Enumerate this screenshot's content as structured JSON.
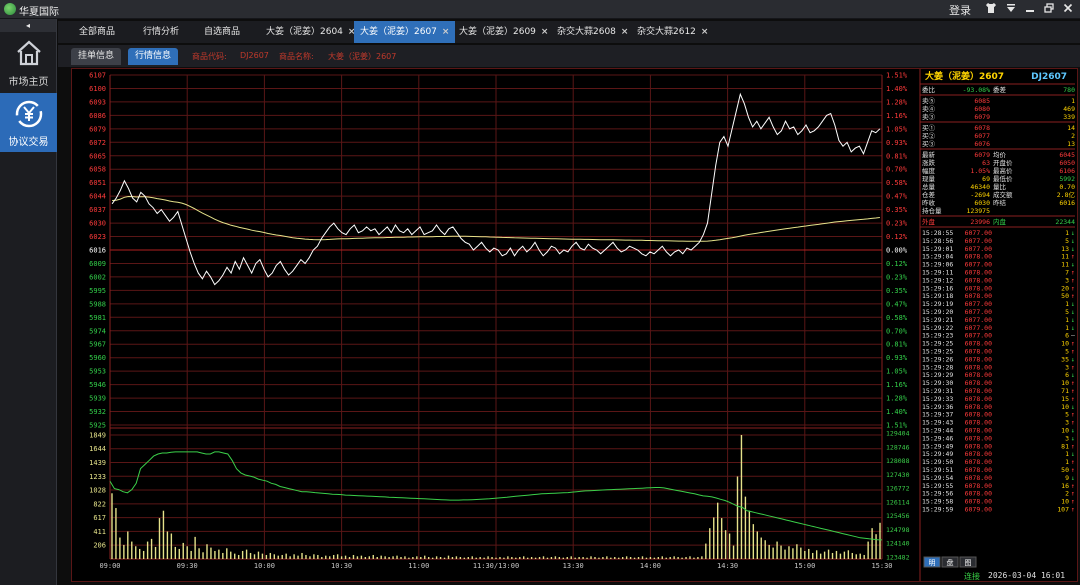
{
  "window": {
    "app_title": "华夏国际",
    "login_label": "登录",
    "icons": [
      "shirt-icon",
      "menu-dropdown-icon",
      "minimize-icon",
      "restore-icon",
      "close-icon"
    ]
  },
  "sidebar": {
    "collapse_glyph": "◂",
    "items": [
      {
        "label": "市场主页",
        "icon": "home-icon",
        "active": false
      },
      {
        "label": "协议交易",
        "icon": "yuan-exchange-icon",
        "active": true
      }
    ]
  },
  "tabs": [
    {
      "label": "全部商品",
      "closable": false,
      "active": false
    },
    {
      "label": "行情分析",
      "closable": false,
      "active": false
    },
    {
      "label": "自选商品",
      "closable": false,
      "active": false
    },
    {
      "label": "大姜（泥姜）2604",
      "closable": true,
      "active": false
    },
    {
      "label": "大姜（泥姜）2607",
      "closable": true,
      "active": true
    },
    {
      "label": "大姜（泥姜）2609",
      "closable": true,
      "active": false
    },
    {
      "label": "杂交大蒜2608",
      "closable": true,
      "active": false
    },
    {
      "label": "杂交大蒜2612",
      "closable": true,
      "active": false
    }
  ],
  "subtabs": {
    "order_info": "挂单信息",
    "quote_info": "行情信息",
    "code_label": "商品代码:",
    "code_value": "DJ2607",
    "name_label": "商品名称:",
    "name_value": "大姜（泥姜）2607"
  },
  "colors": {
    "price_line": "#ffffff",
    "avg_line": "#e5e28a",
    "volume_bar": "#e5e28a",
    "position_line": "#3bd04a",
    "grid": "#5a1616",
    "up": "#ff3b3b",
    "down": "#33d04a",
    "neutral": "#ffffff"
  },
  "chart_data": {
    "type": "line",
    "title": "",
    "price_ticks": [
      "6107",
      "6100",
      "6093",
      "6086",
      "6079",
      "6072",
      "6065",
      "6058",
      "6051",
      "6044",
      "6037",
      "6030",
      "6023",
      "6016",
      "6009",
      "6002",
      "5995",
      "5988",
      "5981",
      "5974",
      "5967",
      "5960",
      "5953",
      "5946",
      "5939",
      "5932",
      "5925"
    ],
    "pct_ticks": [
      "1.51%",
      "1.40%",
      "1.28%",
      "1.16%",
      "1.05%",
      "0.93%",
      "0.81%",
      "0.70%",
      "0.58%",
      "0.47%",
      "0.35%",
      "0.23%",
      "0.12%",
      "0.00%",
      "0.12%",
      "0.23%",
      "0.35%",
      "0.47%",
      "0.58%",
      "0.70%",
      "0.81%",
      "0.93%",
      "1.05%",
      "1.16%",
      "1.28%",
      "1.40%",
      "1.51%"
    ],
    "prev_close": 6016,
    "volume_ticks": [
      "1849",
      "1644",
      "1439",
      "1233",
      "1028",
      "822",
      "617",
      "411",
      "206"
    ],
    "position_ticks": [
      "129404",
      "128746",
      "128088",
      "127430",
      "126772",
      "126114",
      "125456",
      "124798",
      "124140",
      "123482"
    ],
    "time_ticks": [
      "09:00",
      "09:30",
      "10:00",
      "10:30",
      "11:00",
      "11:30/13:00",
      "13:30",
      "14:00",
      "14:30",
      "15:00",
      "15:30"
    ],
    "price_series": [
      6040,
      6043,
      6047,
      6052,
      6048,
      6043,
      6041,
      6046,
      6044,
      6040,
      6038,
      6035,
      6037,
      6034,
      6031,
      6033,
      6036,
      6029,
      6022,
      6015,
      6009,
      6004,
      6001,
      6005,
      6002,
      5998,
      6000,
      6003,
      6007,
      6004,
      6010,
      6006,
      6012,
      6008,
      6004,
      6009,
      6011,
      6006,
      6002,
      6004,
      6008,
      6010,
      6006,
      6003,
      6005,
      6008,
      6011,
      6009,
      6012,
      6016,
      6018,
      6022,
      6025,
      6028,
      6030,
      6027,
      6025,
      6024,
      6027,
      6029,
      6025,
      6026,
      6028,
      6026,
      6027,
      6024,
      6026,
      6028,
      6025,
      6029,
      6026,
      6025,
      6027,
      6024,
      6026,
      6028,
      6024,
      6025,
      6026,
      6029,
      6026,
      6024,
      6027,
      6028,
      6025,
      6022,
      6020,
      6019,
      6016,
      6018,
      6020,
      6017,
      6015,
      6017,
      6016,
      6013,
      6014,
      6017,
      6013,
      6016,
      6018,
      6015,
      6017,
      6020,
      6016,
      6013,
      6015,
      6018,
      6017,
      6014,
      6016,
      6015,
      6018,
      6020,
      6017,
      6016,
      6019,
      6017,
      6016,
      6014,
      6016,
      6018,
      6020,
      6017,
      6015,
      6016,
      6018,
      6017,
      6016,
      6014,
      6013,
      6015,
      6014,
      6016,
      6018,
      6015,
      6013,
      6015,
      6016,
      6014,
      6017,
      6016,
      6018,
      6020,
      6024,
      6030,
      6045,
      6060,
      6072,
      6075,
      6070,
      6079,
      6088,
      6097,
      6092,
      6085,
      6080,
      6083,
      6079,
      6082,
      6085,
      6080,
      6076,
      6078,
      6083,
      6079,
      6080,
      6076,
      6078,
      6081,
      6077,
      6078,
      6080,
      6083,
      6086,
      6087,
      6081,
      6073,
      6070,
      6072,
      6067,
      6069,
      6070,
      6066,
      6072,
      6078,
      6077,
      6079
    ],
    "avg_series_start": 6042,
    "volume_series": [
      980,
      760,
      320,
      210,
      410,
      260,
      190,
      150,
      120,
      260,
      300,
      180,
      610,
      720,
      410,
      380,
      180,
      150,
      240,
      190,
      120,
      330,
      160,
      100,
      220,
      170,
      120,
      140,
      90,
      160,
      110,
      80,
      60,
      120,
      140,
      90,
      70,
      110,
      80,
      60,
      90,
      70,
      50,
      60,
      80,
      40,
      70,
      50,
      90,
      60,
      40,
      70,
      60,
      30,
      50,
      40,
      60,
      70,
      40,
      50,
      30,
      60,
      40,
      50,
      30,
      40,
      60,
      30,
      50,
      40,
      30,
      40,
      50,
      30,
      40,
      20,
      30,
      40,
      30,
      50,
      30,
      20,
      40,
      30,
      20,
      50,
      30,
      40,
      30,
      20,
      30,
      40,
      20,
      30,
      20,
      40,
      30,
      20,
      30,
      20,
      40,
      30,
      20,
      30,
      40,
      20,
      30,
      20,
      30,
      40,
      20,
      30,
      40,
      30,
      20,
      30,
      40,
      20,
      30,
      30,
      20,
      40,
      30,
      20,
      30,
      40,
      20,
      30,
      20,
      30,
      40,
      30,
      20,
      30,
      40,
      20,
      30,
      20,
      30,
      40,
      20,
      30,
      40,
      30,
      20,
      30,
      40,
      20,
      30,
      40,
      230,
      460,
      620,
      840,
      610,
      430,
      380,
      200,
      1230,
      1849,
      930,
      720,
      520,
      410,
      320,
      280,
      210,
      170,
      260,
      200,
      140,
      190,
      160,
      220,
      170,
      120,
      150,
      90,
      130,
      80,
      110,
      140,
      90,
      120,
      80,
      110,
      130,
      90,
      70,
      80,
      60,
      260,
      460,
      370,
      540
    ],
    "position_series": [
      127100,
      126750,
      126700,
      126600,
      126550,
      126700,
      127000,
      127700,
      127900,
      128100,
      128300,
      128400,
      128450,
      128450,
      128480,
      128500,
      128500,
      128500,
      128500,
      128500,
      128500,
      128450,
      128400,
      128400,
      128500,
      128500,
      128450,
      128400,
      128100,
      127700,
      127500,
      127400,
      127350,
      127300,
      127200,
      127150,
      127100,
      127000,
      126950,
      126850,
      126800,
      126750,
      126700,
      126650,
      126600,
      126600,
      126580,
      126560,
      126540,
      126520,
      126500,
      126480,
      126470,
      126460,
      126440,
      126430,
      126420,
      126410,
      126400,
      126390,
      126380,
      126370,
      126360,
      126350,
      126340,
      126330,
      126320,
      126310,
      126300,
      126290,
      126280,
      126270,
      126260,
      126250,
      126240,
      126230,
      126220,
      126210,
      126200,
      126200,
      126200,
      126210,
      126210,
      126220,
      126230,
      126240,
      126250,
      126260,
      126280,
      126300,
      126320,
      126340,
      126360,
      126380,
      126400,
      126420,
      126440,
      126460,
      126480,
      126500,
      126510,
      126520,
      126530,
      126540,
      126550,
      126560,
      126580,
      126600,
      126620,
      126640,
      126650,
      126660,
      126670,
      126680,
      126690,
      126700,
      126710,
      126720,
      126730,
      126740,
      126750,
      126760,
      126770,
      126780,
      126790,
      126800,
      126800,
      126780,
      126740,
      126700,
      126660,
      126620,
      126580,
      126540,
      126500,
      126450,
      126400,
      126380,
      126350,
      126300,
      126240,
      126180,
      126100,
      126000,
      125900,
      125850,
      125700,
      125650,
      125600,
      125550,
      125500,
      125450,
      125400,
      125350,
      125300,
      125250,
      125200,
      125150,
      125100,
      125050,
      125000,
      124950,
      124900,
      124850,
      124800,
      124750,
      124700,
      124650,
      124600,
      124550,
      124500,
      124450,
      124400,
      124380,
      124350,
      124330,
      124310,
      124300
    ]
  },
  "quote_panel": {
    "title": "大姜（泥姜）2607",
    "code": "DJ2607",
    "ratio_label": "委比",
    "ratio_value": "-93.08%",
    "diff_label": "委差",
    "diff_value": "780",
    "asks": [
      {
        "label": "卖⑤",
        "price": "6085",
        "qty": "1"
      },
      {
        "label": "卖④",
        "price": "6080",
        "qty": "469"
      },
      {
        "label": "卖③",
        "price": "6079",
        "qty": "339"
      }
    ],
    "bids": [
      {
        "label": "买①",
        "price": "6078",
        "qty": "14"
      },
      {
        "label": "买②",
        "price": "6077",
        "qty": "2"
      },
      {
        "label": "买③",
        "price": "6076",
        "qty": "13"
      }
    ],
    "stats": [
      {
        "l1": "最新",
        "v1": "6079",
        "c1": "up",
        "l2": "均价",
        "v2": "6045",
        "c2": "up"
      },
      {
        "l1": "涨跌",
        "v1": "63",
        "c1": "up",
        "l2": "开盘价",
        "v2": "6050",
        "c2": "up"
      },
      {
        "l1": "幅度",
        "v1": "1.05%",
        "c1": "up",
        "l2": "最高价",
        "v2": "6106",
        "c2": "up"
      },
      {
        "l1": "现量",
        "v1": "69",
        "c1": "neutral",
        "l2": "最低价",
        "v2": "5992",
        "c2": "down"
      },
      {
        "l1": "总量",
        "v1": "46340",
        "c1": "neutral",
        "l2": "量比",
        "v2": "0.70",
        "c2": "neutral"
      },
      {
        "l1": "仓差",
        "v1": "-2694",
        "c1": "neutral",
        "l2": "成交额",
        "v2": "2.8亿",
        "c2": "neutral"
      },
      {
        "l1": "昨收",
        "v1": "6030",
        "c1": "neutral",
        "l2": "昨结",
        "v2": "6016",
        "c2": "neutral"
      },
      {
        "l1": "持仓量",
        "v1": "123975",
        "c1": "neutral",
        "l2": "",
        "v2": "",
        "c2": "neutral"
      }
    ],
    "outer_label": "外盘",
    "outer_value": "23996",
    "inner_label": "内盘",
    "inner_value": "22344",
    "ticks": [
      {
        "t": "15:28:55",
        "p": "6077.00",
        "v": "1",
        "d": "↓"
      },
      {
        "t": "15:28:56",
        "p": "6077.00",
        "v": "5",
        "d": "↓"
      },
      {
        "t": "15:29:01",
        "p": "6077.00",
        "v": "13",
        "d": "↓"
      },
      {
        "t": "15:29:04",
        "p": "6078.00",
        "v": "11",
        "d": "↑"
      },
      {
        "t": "15:29:06",
        "p": "6077.00",
        "v": "11",
        "d": "↓"
      },
      {
        "t": "15:29:11",
        "p": "6078.00",
        "v": "7",
        "d": "↑"
      },
      {
        "t": "15:29:12",
        "p": "6078.00",
        "v": "3",
        "d": "↑"
      },
      {
        "t": "15:29:16",
        "p": "6078.00",
        "v": "20",
        "d": "↑"
      },
      {
        "t": "15:29:18",
        "p": "6078.00",
        "v": "50",
        "d": "↑"
      },
      {
        "t": "15:29:19",
        "p": "6077.00",
        "v": "1",
        "d": "↓"
      },
      {
        "t": "15:29:20",
        "p": "6077.00",
        "v": "5",
        "d": "↓"
      },
      {
        "t": "15:29:21",
        "p": "6077.00",
        "v": "1",
        "d": "↓"
      },
      {
        "t": "15:29:22",
        "p": "6077.00",
        "v": "1",
        "d": "↓"
      },
      {
        "t": "15:29:23",
        "p": "6077.00",
        "v": "6",
        "d": "—"
      },
      {
        "t": "15:29:25",
        "p": "6078.00",
        "v": "10",
        "d": "↑"
      },
      {
        "t": "15:29:25",
        "p": "6078.00",
        "v": "5",
        "d": "↑"
      },
      {
        "t": "15:29:26",
        "p": "6078.00",
        "v": "35",
        "d": "↓"
      },
      {
        "t": "15:29:28",
        "p": "6078.00",
        "v": "3",
        "d": "↑"
      },
      {
        "t": "15:29:29",
        "p": "6078.00",
        "v": "6",
        "d": "↓"
      },
      {
        "t": "15:29:30",
        "p": "6078.00",
        "v": "10",
        "d": "↑"
      },
      {
        "t": "15:29:31",
        "p": "6078.00",
        "v": "71",
        "d": "↑"
      },
      {
        "t": "15:29:33",
        "p": "6078.00",
        "v": "15",
        "d": "↑"
      },
      {
        "t": "15:29:36",
        "p": "6078.00",
        "v": "10",
        "d": "↓"
      },
      {
        "t": "15:29:37",
        "p": "6078.00",
        "v": "5",
        "d": "↑"
      },
      {
        "t": "15:29:43",
        "p": "6078.00",
        "v": "3",
        "d": "↑"
      },
      {
        "t": "15:29:44",
        "p": "6078.00",
        "v": "10",
        "d": "↓"
      },
      {
        "t": "15:29:46",
        "p": "6078.00",
        "v": "3",
        "d": "↓"
      },
      {
        "t": "15:29:49",
        "p": "6078.00",
        "v": "81",
        "d": "↑"
      },
      {
        "t": "15:29:49",
        "p": "6078.00",
        "v": "1",
        "d": "↓"
      },
      {
        "t": "15:29:50",
        "p": "6078.00",
        "v": "1",
        "d": "↑"
      },
      {
        "t": "15:29:51",
        "p": "6078.00",
        "v": "50",
        "d": "↑"
      },
      {
        "t": "15:29:54",
        "p": "6078.00",
        "v": "9",
        "d": "↓"
      },
      {
        "t": "15:29:55",
        "p": "6078.00",
        "v": "16",
        "d": "↑"
      },
      {
        "t": "15:29:56",
        "p": "6078.00",
        "v": "2",
        "d": "↑"
      },
      {
        "t": "15:29:58",
        "p": "6078.00",
        "v": "10",
        "d": "↑"
      },
      {
        "t": "15:29:59",
        "p": "6079.00",
        "v": "107",
        "d": "↑"
      }
    ],
    "bottom_tabs": [
      "明",
      "盘",
      "图"
    ]
  },
  "status": {
    "connection": "连接",
    "datetime": "2026-03-04 16:01"
  }
}
